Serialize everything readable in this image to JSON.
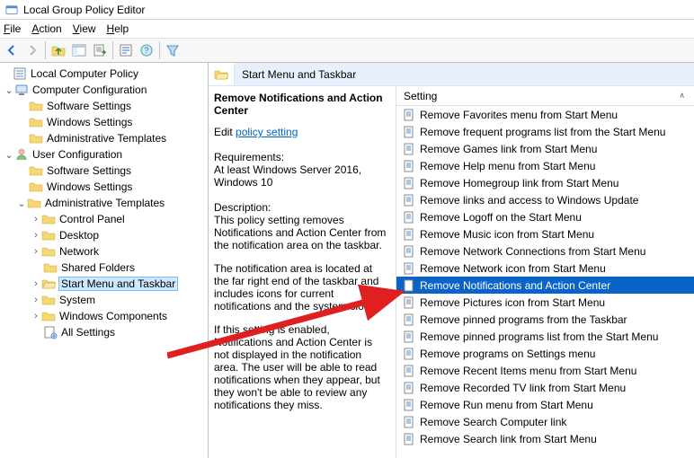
{
  "window": {
    "title": "Local Group Policy Editor"
  },
  "menus": {
    "file": "File",
    "action": "Action",
    "view": "View",
    "help": "Help"
  },
  "tree": {
    "root": "Local Computer Policy",
    "cc": "Computer Configuration",
    "cc_ss": "Software Settings",
    "cc_ws": "Windows Settings",
    "cc_at": "Administrative Templates",
    "uc": "User Configuration",
    "uc_ss": "Software Settings",
    "uc_ws": "Windows Settings",
    "uc_at": "Administrative Templates",
    "cp": "Control Panel",
    "dk": "Desktop",
    "nw": "Network",
    "sf": "Shared Folders",
    "smt": "Start Menu and Taskbar",
    "sys": "System",
    "wc": "Windows Components",
    "as": "All Settings"
  },
  "header": {
    "title": "Start Menu and Taskbar"
  },
  "desc": {
    "title": "Remove Notifications and Action Center",
    "edit_prefix": "Edit ",
    "edit_link": "policy setting",
    "req_h": "Requirements:",
    "req_t": "At least Windows Server 2016, Windows 10",
    "desc_h": "Description:",
    "desc_t": "This policy setting removes Notifications and Action Center from the notification area on the taskbar.",
    "p2": "The notification area is located at the far right end of the taskbar and includes icons for current notifications and the system clock.",
    "p3": "If this setting is enabled, Notifications and Action Center is not displayed in the notification area. The user will be able to read notifications when they appear, but they won't be able to review any notifications they miss."
  },
  "listhead": "Setting",
  "settings": [
    "Remove Favorites menu from Start Menu",
    "Remove frequent programs list from the Start Menu",
    "Remove Games link from Start Menu",
    "Remove Help menu from Start Menu",
    "Remove Homegroup link from Start Menu",
    "Remove links and access to Windows Update",
    "Remove Logoff on the Start Menu",
    "Remove Music icon from Start Menu",
    "Remove Network Connections from Start Menu",
    "Remove Network icon from Start Menu",
    "Remove Notifications and Action Center",
    "Remove Pictures icon from Start Menu",
    "Remove pinned programs from the Taskbar",
    "Remove pinned programs list from the Start Menu",
    "Remove programs on Settings menu",
    "Remove Recent Items menu from Start Menu",
    "Remove Recorded TV link from Start Menu",
    "Remove Run menu from Start Menu",
    "Remove Search Computer link",
    "Remove Search link from Start Menu"
  ],
  "selected_setting_index": 10
}
